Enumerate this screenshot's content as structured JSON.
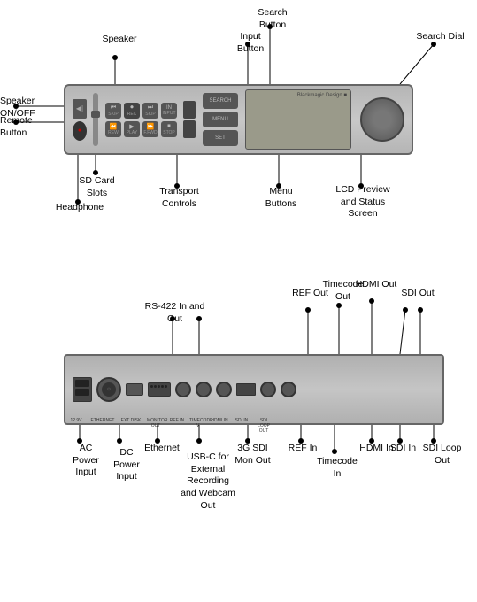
{
  "labels": {
    "speaker": "Speaker",
    "speaker_onoff": "Speaker\nON/OFF",
    "remote_button": "Remote\nButton",
    "search_button": "Search\nButton",
    "input_button": "Input\nButton",
    "search_dial": "Search Dial",
    "sd_card_slots": "SD Card\nSlots",
    "transport_controls": "Transport\nControls",
    "menu_buttons": "Menu\nButtons",
    "lcd_preview": "LCD Preview\nand Status Screen",
    "headphone": "Headphone",
    "rs422": "RS-422 In and Out",
    "ref_out": "REF Out",
    "timecode_out_label": "Timecode\nOut",
    "hdmi_out": "HDMI Out",
    "sdi_out": "SDI Out",
    "ac_power": "AC\nPower\nInput",
    "dc_power": "DC\nPower\nInput",
    "ethernet": "Ethernet",
    "usbc": "USB-C for\nExternal Recording\nand Webcam Out",
    "3g_sdi": "3G SDI\nMon Out",
    "ref_in": "REF In",
    "timecode_in": "Timecode In",
    "hdmi_in": "HDMI In",
    "sdi_in": "SDI In",
    "sdi_loop_out": "SDI Loop\nOut"
  },
  "colors": {
    "dot": "#000000",
    "line": "#000000",
    "panel_bg": "#c0c0c0",
    "panel_border": "#777777",
    "btn_dark": "#444444",
    "btn_medium": "#666666",
    "text": "#000000"
  }
}
